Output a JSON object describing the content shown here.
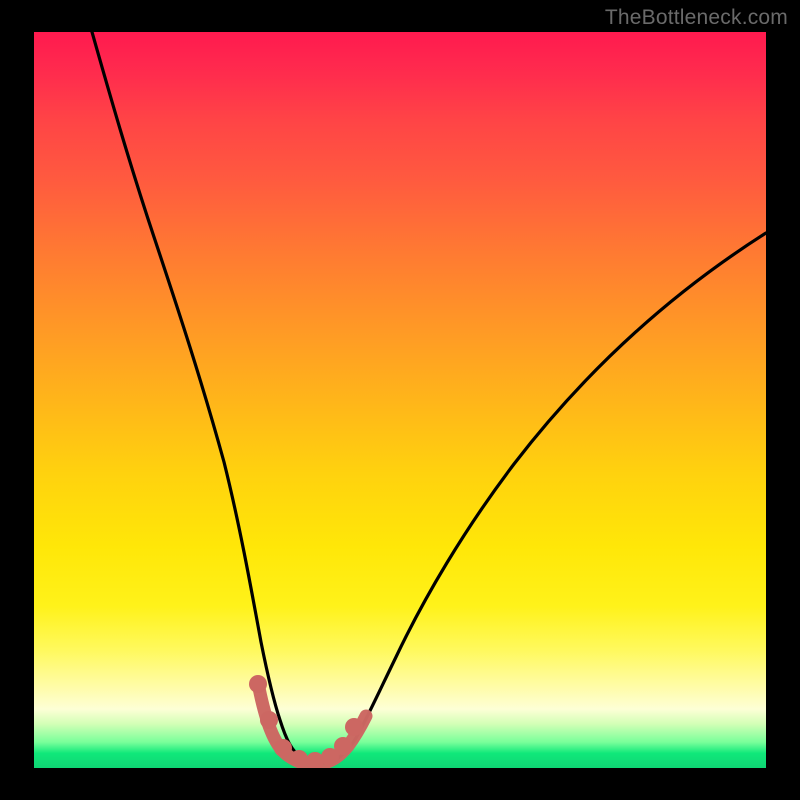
{
  "watermark": "TheBottleneck.com",
  "chart_data": {
    "type": "line",
    "title": "",
    "xlabel": "",
    "ylabel": "",
    "xlim": [
      0,
      100
    ],
    "ylim": [
      0,
      100
    ],
    "series": [
      {
        "name": "bottleneck-curve",
        "x": [
          0,
          4,
          8,
          12,
          16,
          20,
          24,
          27,
          29.5,
          31.5,
          33.5,
          36,
          38.5,
          41,
          44,
          48,
          54,
          62,
          72,
          84,
          94,
          100
        ],
        "y": [
          100,
          93,
          85,
          77,
          67,
          56,
          44,
          30,
          17,
          9,
          4,
          0.8,
          0.5,
          0.8,
          4,
          12,
          23,
          35,
          47,
          58,
          65,
          69
        ]
      },
      {
        "name": "data-point-markers",
        "x": [
          30,
          31.8,
          34,
          36,
          38,
          40,
          41.5,
          43
        ],
        "y": [
          11,
          6.5,
          2.5,
          1.2,
          1.0,
          1.3,
          2.6,
          6.2
        ]
      }
    ],
    "colors": {
      "curve": "#000000",
      "markers_fill": "#cc6762",
      "markers_stroke": "#b9534d"
    }
  }
}
